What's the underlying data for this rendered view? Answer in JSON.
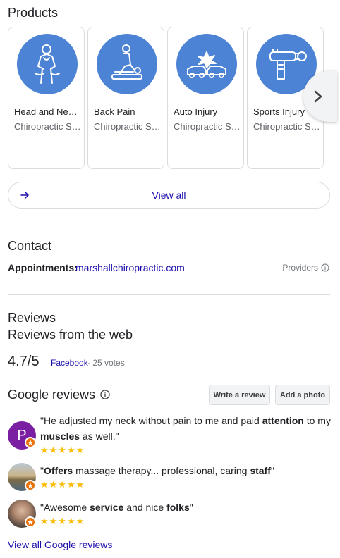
{
  "products": {
    "title": "Products",
    "items": [
      {
        "name": "Head and Neck Pain",
        "category": "Chiropractic Services",
        "icon": "neck-pain-icon"
      },
      {
        "name": "Back Pain",
        "category": "Chiropractic Services",
        "icon": "back-pain-icon"
      },
      {
        "name": "Auto Injury",
        "category": "Chiropractic Services",
        "icon": "auto-injury-icon"
      },
      {
        "name": "Sports Injury",
        "category": "Chiropractic Services",
        "icon": "massage-gun-icon"
      }
    ],
    "view_all": "View all",
    "icon_color": "#4c83d5"
  },
  "contact": {
    "title": "Contact",
    "appointments_label": "Appointments:",
    "appointments_link": "marshallchiropractic.com",
    "providers": "Providers"
  },
  "reviews": {
    "title": "Reviews",
    "from_web": "Reviews from the web",
    "rating": "4.7/5",
    "source": "Facebook",
    "votes": "· 25 votes"
  },
  "google_reviews": {
    "title": "Google reviews",
    "write_review": "Write a review",
    "add_photo": "Add a photo",
    "items": [
      {
        "avatar_letter": "P",
        "avatar_color": "#7b1fa2",
        "stars": 5
      },
      {
        "avatar_letter": "",
        "stars": 5
      },
      {
        "avatar_letter": "",
        "stars": 5
      }
    ],
    "view_all": "View all Google reviews"
  }
}
